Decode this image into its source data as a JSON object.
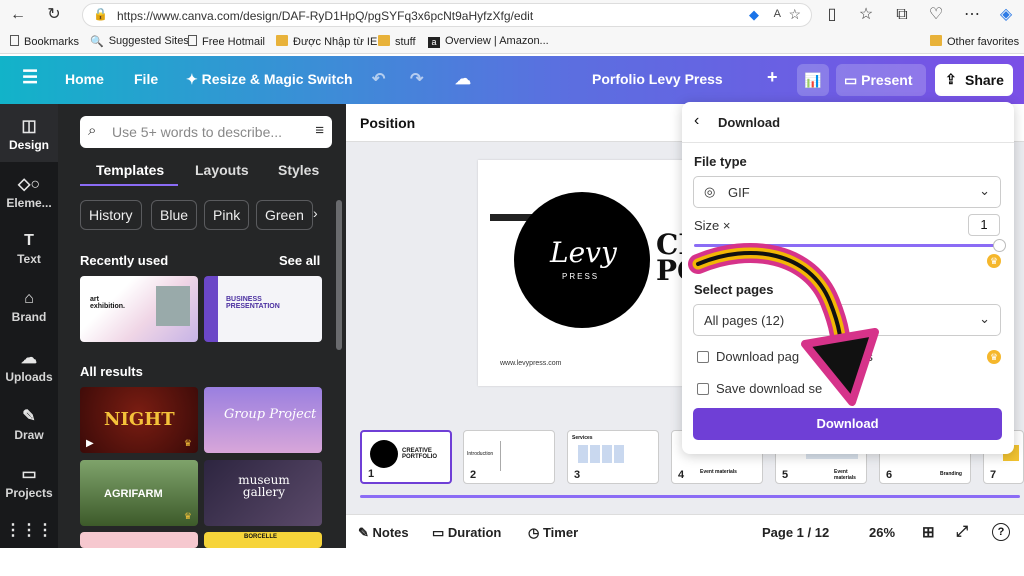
{
  "browser": {
    "url": "https://www.canva.com/design/DAF-RyD1HpQ/pgSYFq3x6pcNt9aHyfzXfg/edit",
    "bookmarks": [
      "Bookmarks",
      "Suggested Sites",
      "Free Hotmail",
      "Được Nhập từ IE",
      "stuff",
      "Overview | Amazon...",
      "Other favorites"
    ]
  },
  "header": {
    "menu_icon": "hamburger-icon",
    "home": "Home",
    "file": "File",
    "resize": "Resize & Magic Switch",
    "doc_title": "Porfolio Levy Press",
    "present": "Present",
    "share": "Share"
  },
  "rail": {
    "items": [
      "Design",
      "Eleme...",
      "Text",
      "Brand",
      "Uploads",
      "Draw",
      "Projects"
    ]
  },
  "panel": {
    "search_placeholder": "Use 5+ words to describe...",
    "tabs": [
      "Templates",
      "Layouts",
      "Styles"
    ],
    "chips": [
      "History",
      "Blue",
      "Pink",
      "Green"
    ],
    "recently_used": "Recently used",
    "see_all": "See all",
    "all_results": "All results",
    "thumbs": {
      "art": "art exhibition.",
      "business": "BUSINESS PRESENTATION",
      "night": "NIGHT",
      "group": "Group Project",
      "agrifarm": "AGRIFARM",
      "museum": "museum gallery",
      "borcelle": "BORCELLE"
    }
  },
  "canvas": {
    "position_label": "Position",
    "logo_word": "Levy",
    "logo_sub": "PRESS",
    "big_text_1": "CI",
    "big_text_2": "PO",
    "website": "www.levypress.com",
    "pages": [
      {
        "n": "1",
        "label": "CREATIVE PORTFOLIO"
      },
      {
        "n": "2",
        "label": "Introduction"
      },
      {
        "n": "3",
        "label": "Services"
      },
      {
        "n": "4",
        "label": "Event materials"
      },
      {
        "n": "5",
        "label": "Event materials"
      },
      {
        "n": "6",
        "label": "Branding"
      },
      {
        "n": "7",
        "label": ""
      }
    ]
  },
  "footer": {
    "notes": "Notes",
    "duration": "Duration",
    "timer": "Timer",
    "page": "Page 1 / 12",
    "zoom": "26%"
  },
  "download": {
    "title": "Download",
    "file_type_label": "File type",
    "file_type": "GIF",
    "size_label": "Size ×",
    "size_value": "1",
    "select_pages_label": "Select pages",
    "pages_value": "All pages (12)",
    "opt1": "Download pag        ate files",
    "opt2": "Save download se",
    "button": "Download"
  },
  "colors": {
    "accent": "#6f3fd6",
    "arrow_outline": "#d6338a",
    "arrow_fill": "#f2b705"
  }
}
